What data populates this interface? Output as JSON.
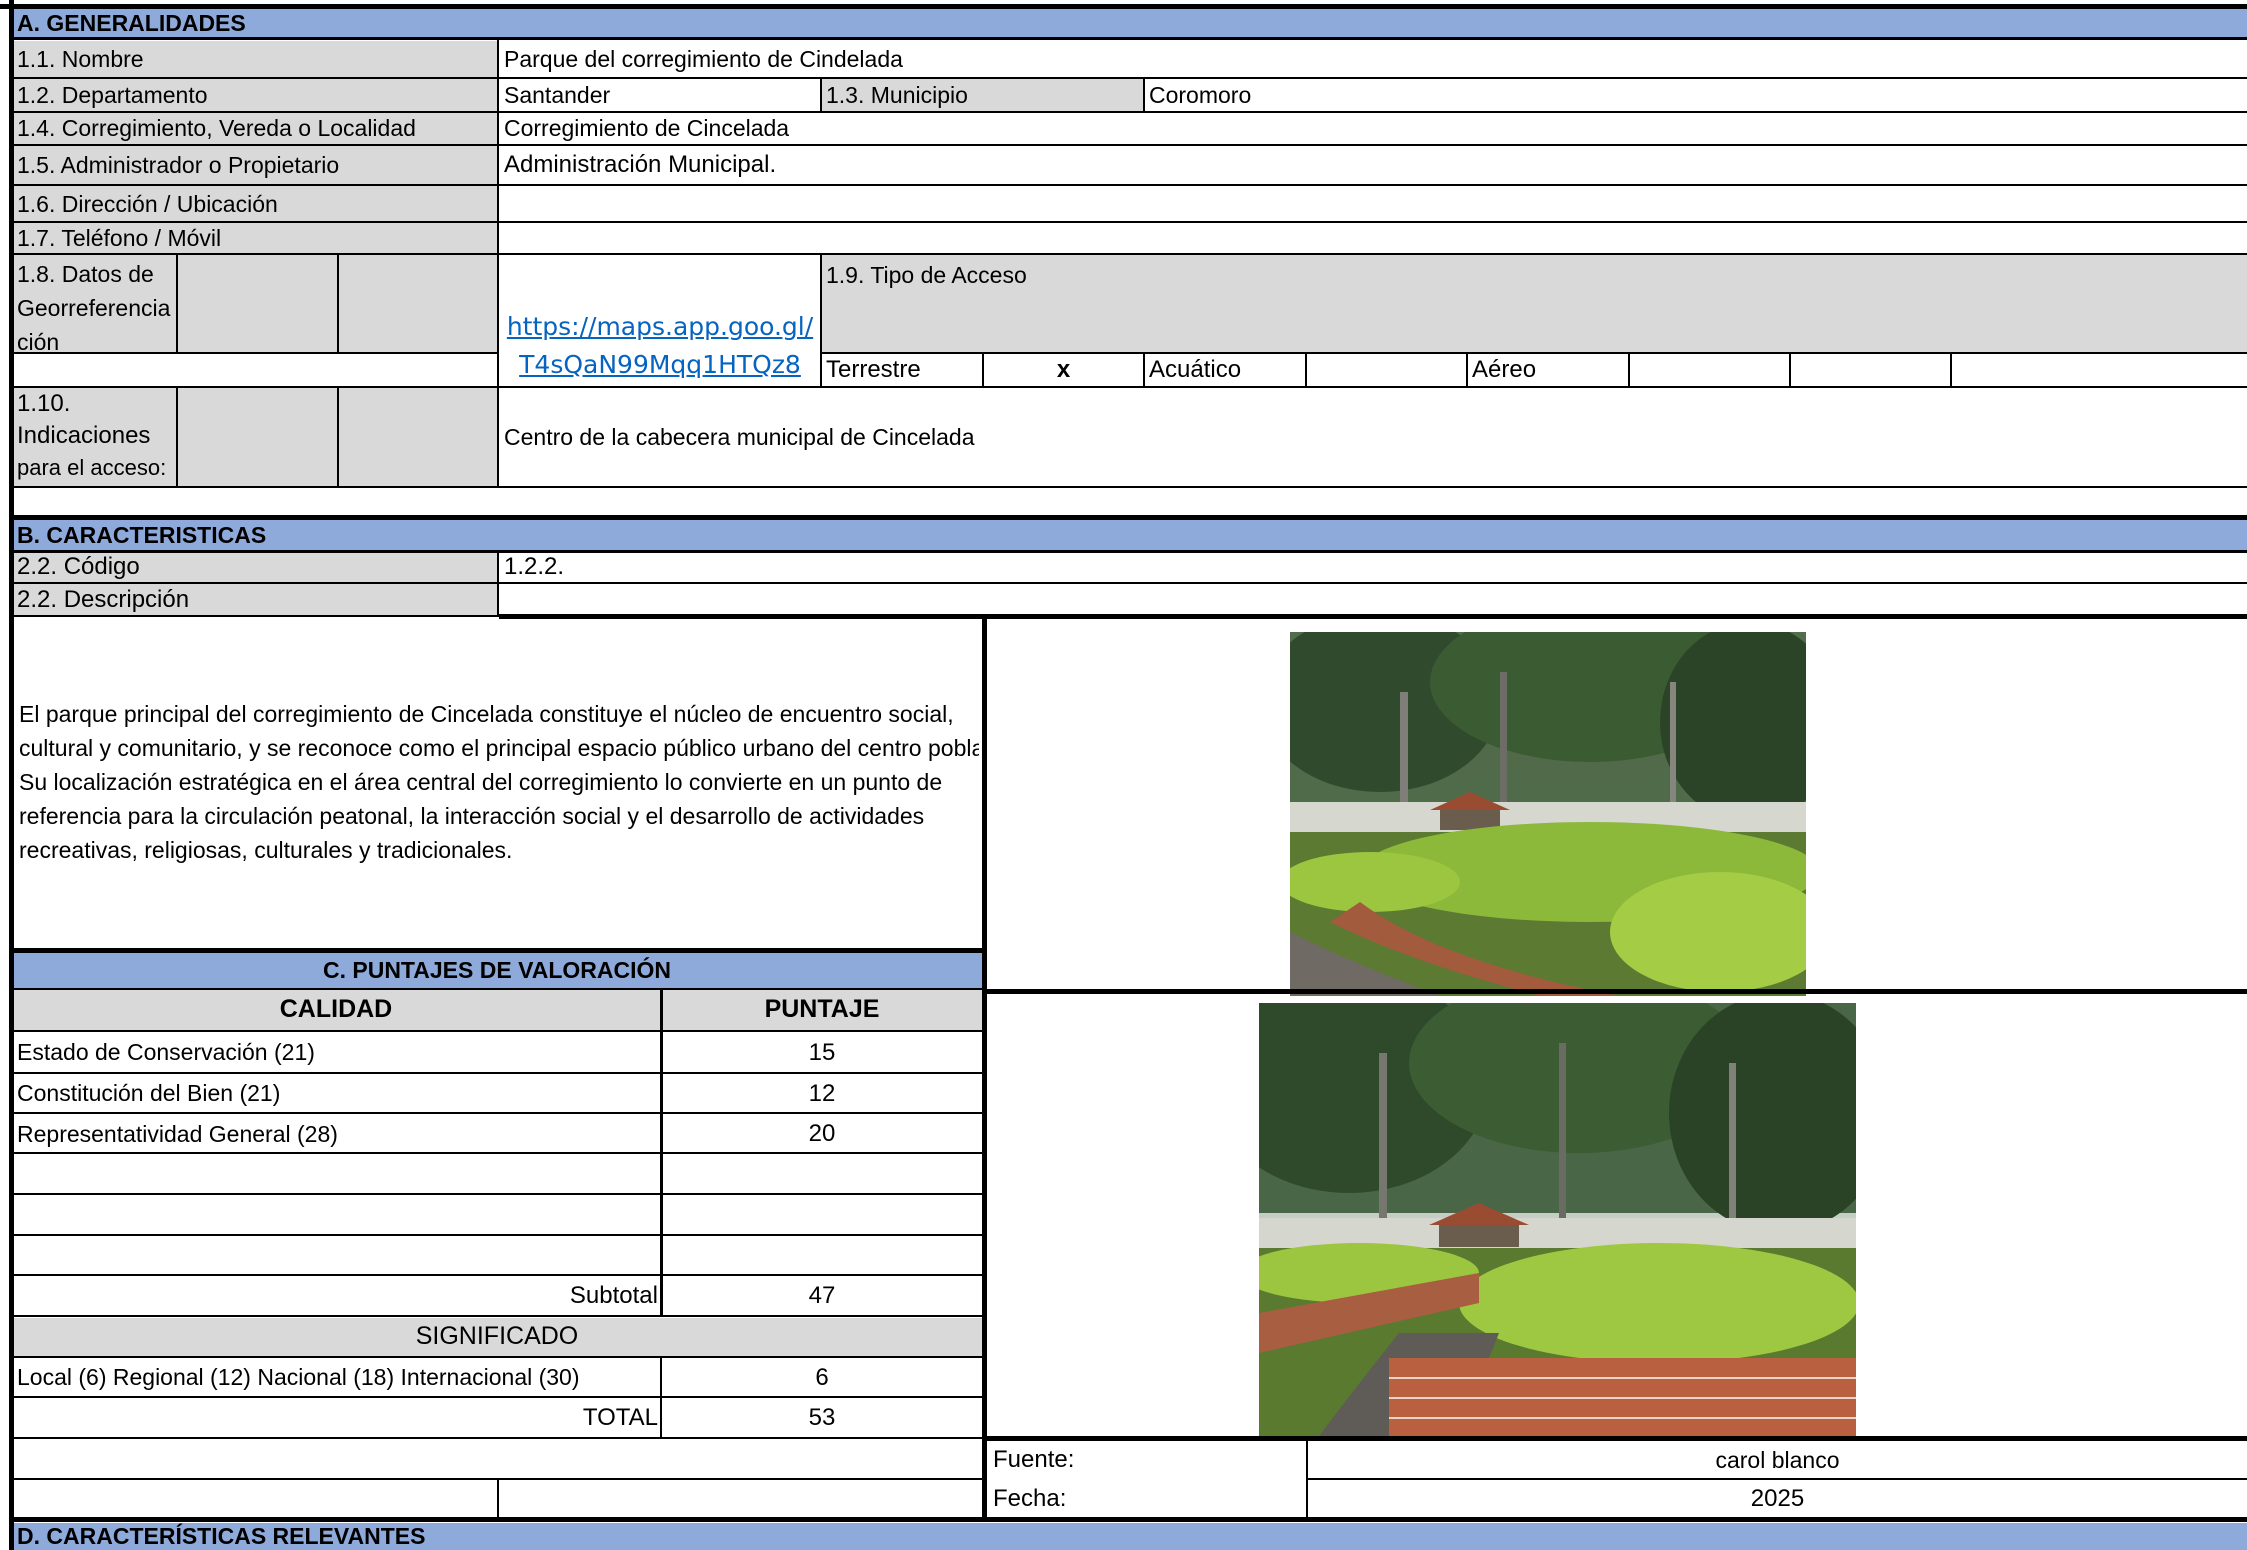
{
  "section_a": {
    "title": "A. GENERALIDADES",
    "nombre_label": "1.1. Nombre",
    "nombre_value": "Parque del corregimiento de Cindelada",
    "departamento_label": "1.2. Departamento",
    "departamento_value": "Santander",
    "municipio_label": "1.3. Municipio",
    "municipio_value": "Coromoro",
    "localidad_label": "1.4. Corregimiento, Vereda o Localidad",
    "localidad_value": "Corregimiento de Cincelada",
    "administrador_label": "1.5. Administrador o Propietario",
    "administrador_value": "Administración Municipal.",
    "direccion_label": "1.6. Dirección / Ubicación",
    "direccion_value": "",
    "telefono_label": "1.7. Teléfono / Móvil",
    "telefono_value": "",
    "georef_label_1": "1.8. Datos de",
    "georef_label_2": "Georreferencia",
    "georef_label_3": "ción",
    "georef_link_1": "https://maps.app.goo.gl/",
    "georef_link_2": "T4sQaN99Mqq1HTQz8",
    "acceso_label": "1.9. Tipo de Acceso",
    "terrestre_label": "Terrestre",
    "terrestre_mark": "x",
    "acuatico_label": "Acuático",
    "aereo_label": "Aéreo",
    "indicaciones_label_1": "1.10.",
    "indicaciones_label_2": "Indicaciones",
    "indicaciones_label_3": "para el acceso:",
    "indicaciones_value": "Centro de la cabecera municipal de Cincelada"
  },
  "section_b": {
    "title": "B. CARACTERISTICAS",
    "codigo_label": "2.2. Código",
    "codigo_value": "1.2.2.",
    "descripcion_label": "2.2. Descripción",
    "descripcion_lines": [
      "El parque principal del corregimiento de Cincelada constituye el núcleo de encuentro social,",
      "cultural y comunitario, y se reconoce como el principal espacio público urbano del centro poblado.",
      "Su localización estratégica en el área central del corregimiento lo convierte en un punto de",
      "referencia para la circulación peatonal, la interacción social y el desarrollo de actividades",
      "recreativas, religiosas, culturales y tradicionales."
    ]
  },
  "section_c": {
    "title": "C. PUNTAJES DE VALORACIÓN",
    "calidad_header": "CALIDAD",
    "puntaje_header": "PUNTAJE",
    "rows": [
      {
        "label": "Estado de Conservación (21)",
        "value": "15"
      },
      {
        "label": "Constitución del Bien (21)",
        "value": "12"
      },
      {
        "label": "Representatividad General (28)",
        "value": "20"
      }
    ],
    "subtotal_label": "Subtotal",
    "subtotal_value": "47",
    "significado_label": "SIGNIFICADO",
    "significado_row_label": "Local (6) Regional (12) Nacional (18) Internacional (30)",
    "significado_value": "6",
    "total_label": "TOTAL",
    "total_value": "53"
  },
  "photo_meta": {
    "fuente_label": "Fuente:",
    "fuente_value": "carol blanco",
    "fecha_label": "Fecha:",
    "fecha_value": "2025"
  },
  "section_d": {
    "title": "D. CARACTERÍSTICAS RELEVANTES"
  },
  "colors": {
    "section_header": "#8eaadb",
    "label_fill": "#d9d9d9",
    "link": "#0563c1"
  }
}
